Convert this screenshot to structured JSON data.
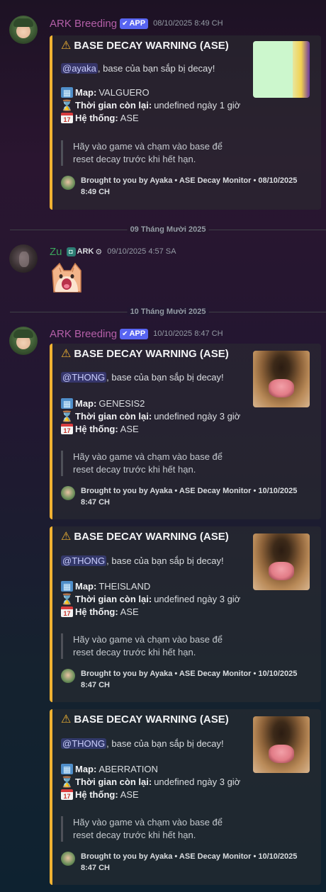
{
  "messages": [
    {
      "author": "ARK Breeding",
      "app_badge": "APP",
      "timestamp": "08/10/2025 8:49 CH",
      "embed": {
        "title": "BASE DECAY WARNING (ASE)",
        "mention": "@ayaka",
        "desc_rest": ", base của bạn sắp bị decay!",
        "map_label": "Map:",
        "map_value": "VALGUERO",
        "time_label": "Thời gian còn lại:",
        "time_value": "undefined ngày 1 giờ",
        "system_label": "Hệ thống:",
        "system_value": "ASE",
        "quote": "Hãy vào game và chạm vào base để reset decay trước khi hết hạn.",
        "footer": "Brought to you by Ayaka • ASE Decay Monitor • 08/10/2025 8:49 CH"
      }
    },
    {
      "author": "Zu",
      "role_tag": "ARK",
      "timestamp": "09/10/2025 4:57 SA"
    },
    {
      "author": "ARK Breeding",
      "app_badge": "APP",
      "timestamp": "10/10/2025 8:47 CH",
      "embeds": [
        {
          "title": "BASE DECAY WARNING (ASE)",
          "mention": "@THONG",
          "desc_rest": ", base của bạn sắp bị decay!",
          "map_label": "Map:",
          "map_value": "GENESIS2",
          "time_label": "Thời gian còn lại:",
          "time_value": "undefined ngày 3 giờ",
          "system_label": "Hệ thống:",
          "system_value": "ASE",
          "quote": "Hãy vào game và chạm vào base để reset decay trước khi hết hạn.",
          "footer": "Brought to you by Ayaka • ASE Decay Monitor • 10/10/2025 8:47 CH"
        },
        {
          "title": "BASE DECAY WARNING (ASE)",
          "mention": "@THONG",
          "desc_rest": ", base của bạn sắp bị decay!",
          "map_label": "Map:",
          "map_value": "THEISLAND",
          "time_label": "Thời gian còn lại:",
          "time_value": "undefined ngày 3 giờ",
          "system_label": "Hệ thống:",
          "system_value": "ASE",
          "quote": "Hãy vào game và chạm vào base để reset decay trước khi hết hạn.",
          "footer": "Brought to you by Ayaka • ASE Decay Monitor • 10/10/2025 8:47 CH"
        },
        {
          "title": "BASE DECAY WARNING (ASE)",
          "mention": "@THONG",
          "desc_rest": ", base của bạn sắp bị decay!",
          "map_label": "Map:",
          "map_value": "ABERRATION",
          "time_label": "Thời gian còn lại:",
          "time_value": "undefined ngày 3 giờ",
          "system_label": "Hệ thống:",
          "system_value": "ASE",
          "quote": "Hãy vào game và chạm vào base để reset decay trước khi hết hạn.",
          "footer": "Brought to you by Ayaka • ASE Decay Monitor • 10/10/2025 8:47 CH"
        }
      ]
    }
  ],
  "dividers": [
    "09 Tháng Mười 2025",
    "10 Tháng Mười 2025"
  ],
  "colors": {
    "embed_accent": "#f0b232",
    "ark_author": "#b45fa8",
    "zu_author": "#3ba55c",
    "app_badge": "#5865f2"
  },
  "icons": [
    "warning-icon",
    "map-icon",
    "hourglass-icon",
    "calendar-icon",
    "check-icon",
    "shield-icon",
    "gear-icon"
  ]
}
